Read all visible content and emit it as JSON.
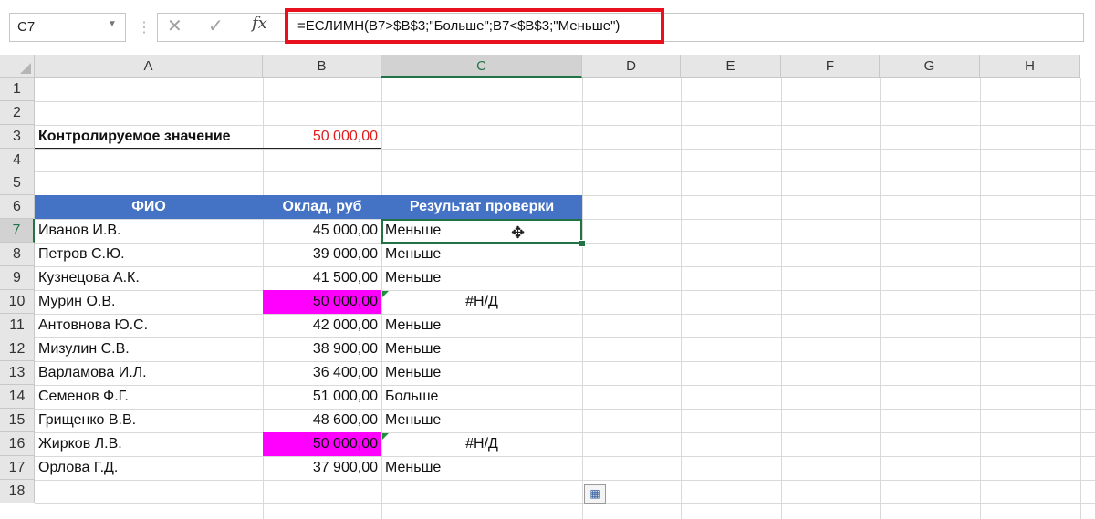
{
  "formula_bar": {
    "name_box": "C7",
    "cancel_icon": "✕",
    "enter_icon": "✓",
    "fx_label": "fx",
    "formula": "=ЕСЛИМН(B7>$B$3;\"Больше\";B7<$B$3;\"Меньше\")"
  },
  "columns": [
    "A",
    "B",
    "C",
    "D",
    "E",
    "F",
    "G",
    "H"
  ],
  "rows": [
    "1",
    "2",
    "3",
    "4",
    "5",
    "6",
    "7",
    "8",
    "9",
    "10",
    "11",
    "12",
    "13",
    "14",
    "15",
    "16",
    "17",
    "18"
  ],
  "sheet": {
    "control_label": "Контролируемое значение",
    "control_value": "50 000,00",
    "table_headers": {
      "name": "ФИО",
      "salary": "Оклад, руб",
      "result": "Результат проверки"
    },
    "records": [
      {
        "name": "Иванов И.В.",
        "salary": "45 000,00",
        "result": "Меньше"
      },
      {
        "name": "Петров С.Ю.",
        "salary": "39 000,00",
        "result": "Меньше"
      },
      {
        "name": "Кузнецова А.К.",
        "salary": "41 500,00",
        "result": "Меньше"
      },
      {
        "name": "Мурин О.В.",
        "salary": "50 000,00",
        "result": "#Н/Д"
      },
      {
        "name": "Антовнова Ю.С.",
        "salary": "42 000,00",
        "result": "Меньше"
      },
      {
        "name": "Мизулин С.В.",
        "salary": "38 900,00",
        "result": "Меньше"
      },
      {
        "name": "Варламова И.Л.",
        "salary": "36 400,00",
        "result": "Меньше"
      },
      {
        "name": "Семенов Ф.Г.",
        "salary": "51 000,00",
        "result": "Больше"
      },
      {
        "name": "Грищенко В.В.",
        "salary": "48 600,00",
        "result": "Меньше"
      },
      {
        "name": "Жирков Л.В.",
        "salary": "50 000,00",
        "result": "#Н/Д"
      },
      {
        "name": "Орлова Г.Д.",
        "salary": "37 900,00",
        "result": "Меньше"
      }
    ]
  },
  "colors": {
    "highlight_border": "#e8101e",
    "header_fill": "#4472c4",
    "magenta_fill": "#ff00ff",
    "selection": "#217346"
  },
  "icons": {
    "cursor": "cross-cursor-icon",
    "paste_options": "paste-options-icon"
  }
}
